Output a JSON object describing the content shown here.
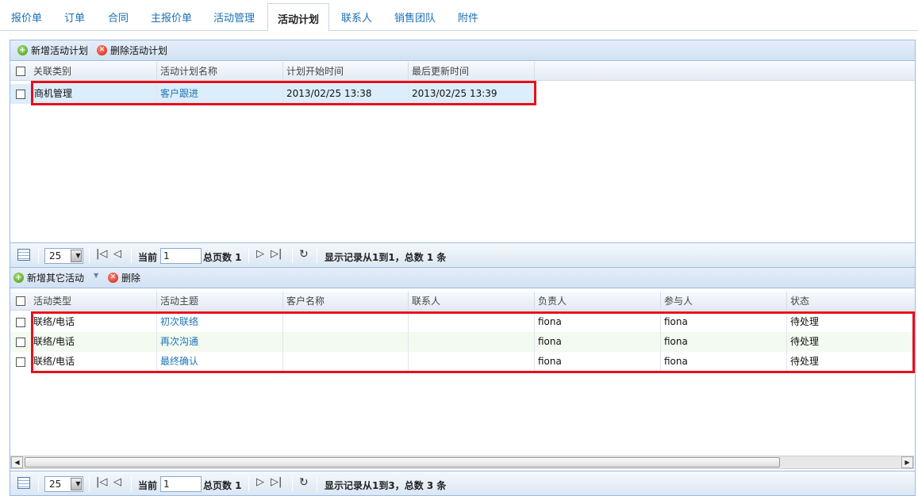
{
  "tabs": [
    {
      "label": "报价单"
    },
    {
      "label": "订单"
    },
    {
      "label": "合同"
    },
    {
      "label": "主报价单"
    },
    {
      "label": "活动管理"
    },
    {
      "label": "活动计划"
    },
    {
      "label": "联系人"
    },
    {
      "label": "销售团队"
    },
    {
      "label": "附件"
    }
  ],
  "active_tab": "活动计划",
  "plans": {
    "toolbar": {
      "add_label": "新增活动计划",
      "delete_label": "删除活动计划"
    },
    "columns": [
      "关联类别",
      "活动计划名称",
      "计划开始时间",
      "最后更新时间"
    ],
    "rows": [
      {
        "category": "商机管理",
        "name": "客户跟进",
        "start": "2013/02/25 13:38",
        "updated": "2013/02/25 13:39"
      }
    ],
    "pager": {
      "page_size": "25",
      "current_label": "当前",
      "current_page": "1",
      "total_label": "总页数 1",
      "info": "显示记录从1到1，总数 1 条"
    }
  },
  "activities": {
    "toolbar": {
      "add_label": "新增其它活动",
      "delete_label": "删除"
    },
    "columns": [
      "活动类型",
      "活动主题",
      "客户名称",
      "联系人",
      "负责人",
      "参与人",
      "状态"
    ],
    "rows": [
      {
        "type": "联络/电话",
        "subject": "初次联络",
        "customer": "",
        "contact": "",
        "owner": "fiona",
        "participant": "fiona",
        "status": "待处理"
      },
      {
        "type": "联络/电话",
        "subject": "再次沟通",
        "customer": "",
        "contact": "",
        "owner": "fiona",
        "participant": "fiona",
        "status": "待处理"
      },
      {
        "type": "联络/电话",
        "subject": "最终确认",
        "customer": "",
        "contact": "",
        "owner": "fiona",
        "participant": "fiona",
        "status": "待处理"
      }
    ],
    "pager": {
      "page_size": "25",
      "current_label": "当前",
      "current_page": "1",
      "total_label": "总页数 1",
      "info": "显示记录从1到3，总数 3 条"
    }
  },
  "icons": {
    "add": "add-circle-icon",
    "delete": "delete-circle-icon",
    "grid": "grid-icon",
    "first": "first-page-icon",
    "prev": "prev-page-icon",
    "next": "next-page-icon",
    "last": "last-page-icon",
    "refresh": "refresh-icon"
  },
  "colors": {
    "link": "#1e74b8",
    "highlight_border": "#e8101a",
    "selected_row": "#dcedfb",
    "alt_row": "#f3faef"
  }
}
